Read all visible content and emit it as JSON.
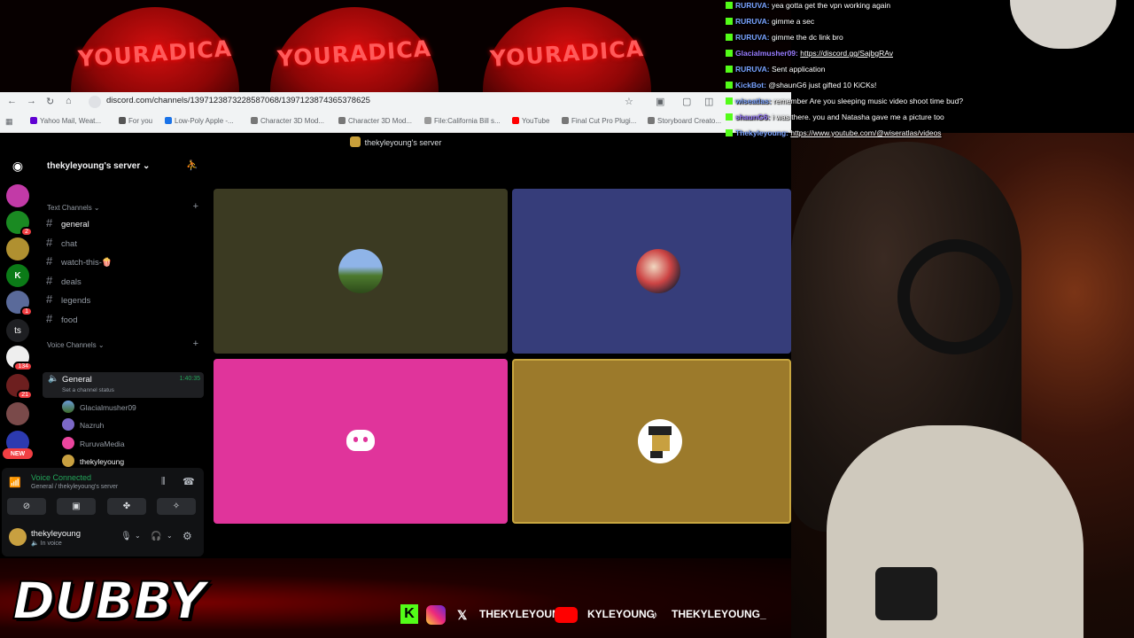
{
  "banner": {
    "cap_text": "YOURADICA"
  },
  "browser": {
    "url": "discord.com/channels/1397123873228587068/1397123874365378625",
    "bookmarks": [
      "Yahoo Mail, Weat...",
      "For you",
      "Low-Poly Apple -...",
      "Character 3D Mod...",
      "Character 3D Mod...",
      "File:California Bill s...",
      "YouTube",
      "Final Cut Pro Plugi...",
      "Storyboard Creato..."
    ]
  },
  "discord": {
    "window_title": "thekyleyoung's server",
    "server_name": "thekyleyoung's server",
    "guild_badges": [
      "2",
      "1",
      "134",
      "21",
      "NEW"
    ],
    "guild_ts": "ts",
    "text_category": "Text Channels",
    "text_channels": [
      "general",
      "chat",
      "watch-this-🍿",
      "deals",
      "legends",
      "food"
    ],
    "voice_category": "Voice Channels",
    "voice_channel": {
      "name": "General",
      "timer": "1:40:35",
      "status": "Set a channel status"
    },
    "voice_users": [
      "Glacialmusher09",
      "Nazruh",
      "RuruvaMedia",
      "thekyleyoung"
    ],
    "panel": {
      "title": "Voice Connected",
      "subtitle": "General / thekyleyoung's server"
    },
    "user": {
      "name": "thekyleyoung",
      "status": "In voice"
    }
  },
  "stream": {
    "brand": "DUBBY",
    "socials": [
      {
        "handle": "THEKYLEYOUNG"
      },
      {
        "handle": "KYLEYOUNG"
      },
      {
        "handle": "THEKYLEYOUNG_"
      }
    ]
  },
  "chat": [
    {
      "user": "RURUVA:",
      "text": "yea gotta get the vpn working again",
      "color": "#7aa2ff"
    },
    {
      "user": "RURUVA:",
      "text": "gimme a sec",
      "color": "#7aa2ff"
    },
    {
      "user": "RURUVA:",
      "text": "gimme the dc link bro",
      "color": "#7aa2ff"
    },
    {
      "user": "Glacialmusher09:",
      "text": "https://discord.gg/SajbgRAv",
      "color": "#9a7bff"
    },
    {
      "user": "RURUVA:",
      "text": "Sent application",
      "color": "#7aa2ff"
    },
    {
      "user": "KickBot:",
      "text": "@shaunG6 just gifted 10 KiCKs!",
      "color": "#7aa2ff"
    },
    {
      "user": "wiseatlas:",
      "text": "remember Are you sleeping music video shoot time bud?",
      "color": "#7aa2ff"
    },
    {
      "user": "shaunG6:",
      "text": "i was there. you and Natasha gave me a picture too",
      "color": "#9a7bff"
    },
    {
      "user": "Thekyleyoung:",
      "text": "https://www.youtube.com/@wiseratlas/videos",
      "color": "#7aa2ff"
    }
  ],
  "colors": {
    "tile_olive": "#3b3a22",
    "tile_blue": "#363d7a",
    "tile_pink": "#e0349b",
    "tile_gold": "#9c7a2b",
    "kick_green": "#53fc18"
  }
}
